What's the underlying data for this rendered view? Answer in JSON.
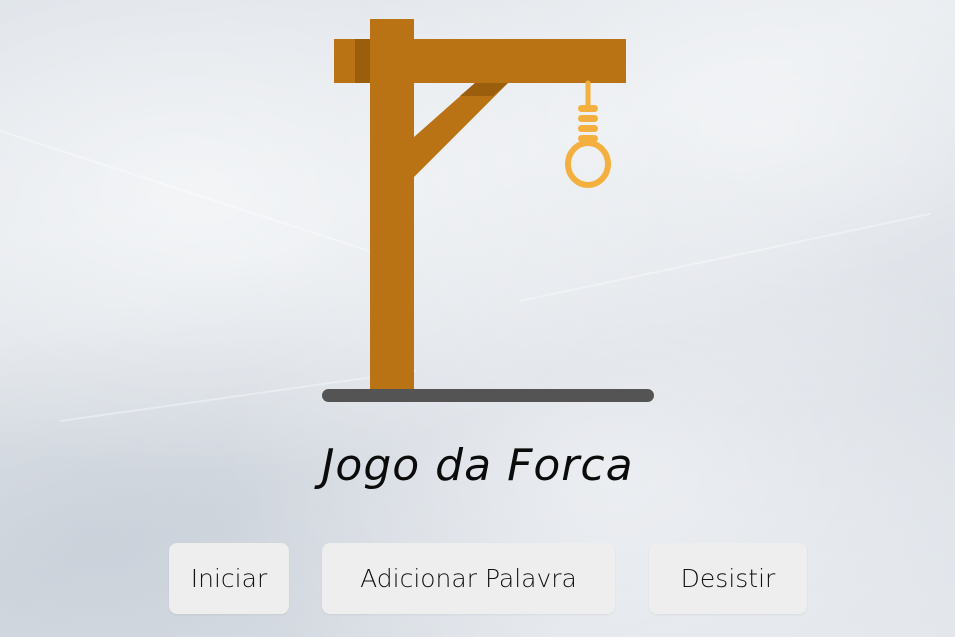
{
  "title": "Jogo da Forca",
  "buttons": {
    "start": "Iniciar",
    "add_word": "Adicionar Palavra",
    "give_up": "Desistir"
  },
  "colors": {
    "wood": "#b97314",
    "wood_shadow": "#9a5e0c",
    "rope": "#f4b03e",
    "ground": "#545454",
    "button_bg": "#eeeeef"
  },
  "icons": {
    "gallows": "gallows-illustration"
  }
}
